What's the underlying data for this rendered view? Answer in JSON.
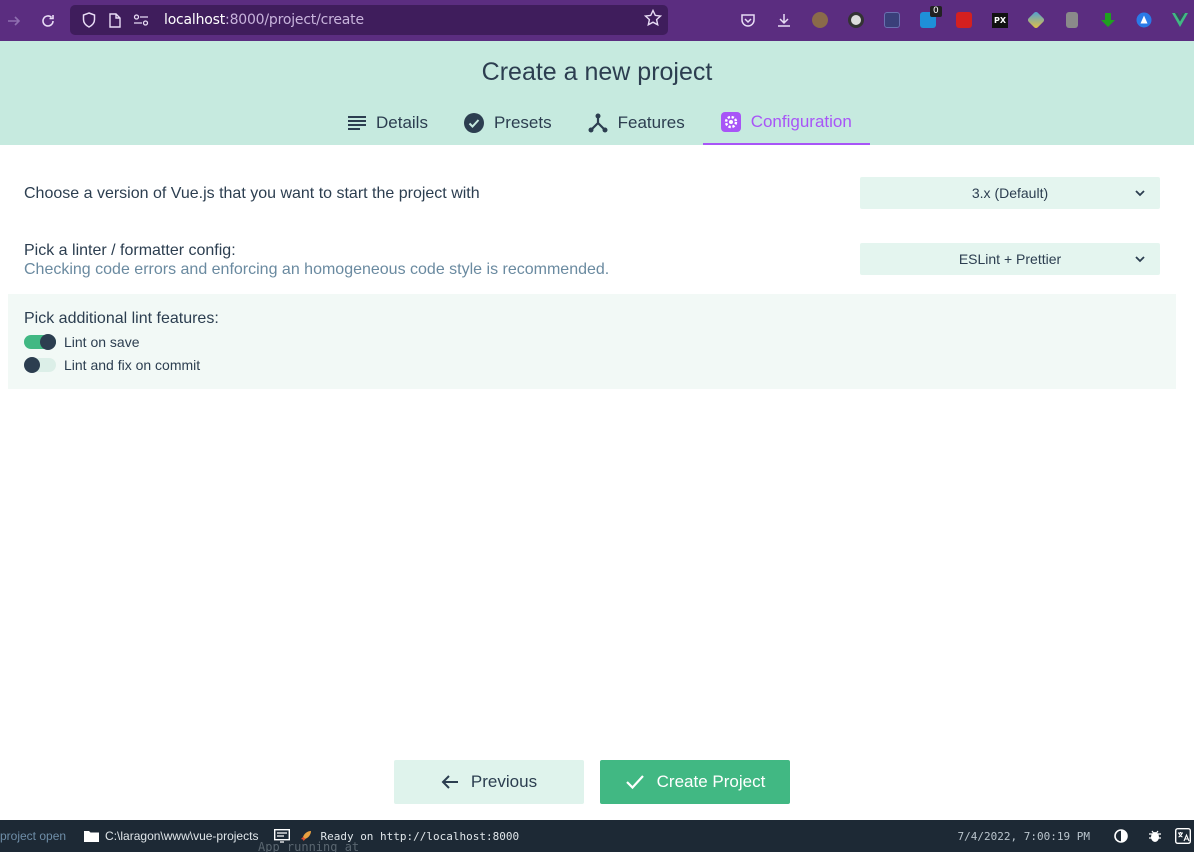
{
  "browser": {
    "url_host": "localhost",
    "url_path": ":8000/project/create",
    "extension_badge": "0",
    "extensions": [
      "pocket-icon",
      "download-icon",
      "avatar-extension-icon",
      "ball-extension-icon",
      "notion-extension-icon",
      "badge-extension-icon",
      "red-extension-icon",
      "px-extension-icon",
      "pen-extension-icon",
      "gray-extension-icon",
      "green-arrow-extension-icon",
      "blue-triangle-extension-icon",
      "vue-devtools-icon"
    ],
    "px_label": "PX"
  },
  "header": {
    "title": "Create a new project",
    "tabs": [
      {
        "label": "Details",
        "icon": "list-icon"
      },
      {
        "label": "Presets",
        "icon": "check-circle-icon"
      },
      {
        "label": "Features",
        "icon": "fork-icon"
      },
      {
        "label": "Configuration",
        "icon": "gear-icon"
      }
    ],
    "active_tab": "Configuration"
  },
  "config": {
    "vue_version_label": "Choose a version of Vue.js that you want to start the project with",
    "vue_version_value": "3.x (Default)",
    "linter_label": "Pick a linter / formatter config:",
    "linter_sub": "Checking code errors and enforcing an homogeneous code style is recommended.",
    "linter_value": "ESLint + Prettier",
    "lint_features_label": "Pick additional lint features:",
    "lint_features": [
      {
        "label": "Lint on save",
        "enabled": true
      },
      {
        "label": "Lint and fix on commit",
        "enabled": false
      }
    ]
  },
  "actions": {
    "previous_label": "Previous",
    "create_label": "Create Project"
  },
  "status_bar": {
    "open_text": "project open",
    "path": "C:\\laragon\\www\\vue-projects",
    "log": "Ready on http://localhost:8000",
    "timestamp": "7/4/2022, 7:00:19 PM",
    "ghost_text": "App running at"
  },
  "colors": {
    "accent": "#a855f7",
    "primary": "#41b883",
    "header_bg": "#c6eadf",
    "browser_bg": "#5b2d80"
  }
}
